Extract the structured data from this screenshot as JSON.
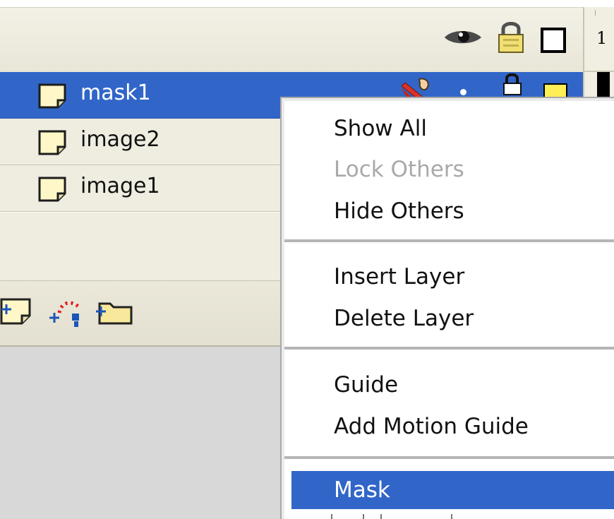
{
  "timeline": {
    "frame_number": "1",
    "header_icons": [
      "eye-icon",
      "lock-icon",
      "outline-icon"
    ],
    "layers": [
      {
        "name": "mask1",
        "selected": true,
        "icon": "layer-page-icon"
      },
      {
        "name": "image2",
        "selected": false,
        "icon": "layer-page-icon"
      },
      {
        "name": "image1",
        "selected": false,
        "icon": "layer-page-icon"
      }
    ],
    "row_icons": [
      "pencil-icon",
      "dot-icon",
      "lock-icon",
      "color-box-icon"
    ],
    "tools": [
      "insert-layer-icon",
      "add-motion-guide-icon",
      "insert-folder-icon"
    ]
  },
  "context_menu": {
    "groups": [
      [
        {
          "label": "Show All",
          "enabled": true
        },
        {
          "label": "Lock Others",
          "enabled": false
        },
        {
          "label": "Hide Others",
          "enabled": true
        }
      ],
      [
        {
          "label": "Insert Layer",
          "enabled": true
        },
        {
          "label": "Delete Layer",
          "enabled": true
        }
      ],
      [
        {
          "label": "Guide",
          "enabled": true
        },
        {
          "label": "Add Motion Guide",
          "enabled": true
        }
      ],
      [
        {
          "label": "Mask",
          "enabled": true,
          "highlighted": true
        }
      ]
    ]
  },
  "colors": {
    "selection": "#3166c8",
    "panel": "#efede0",
    "disabled_text": "#a9a9a9",
    "layer_color_swatch": "#ffee55"
  }
}
